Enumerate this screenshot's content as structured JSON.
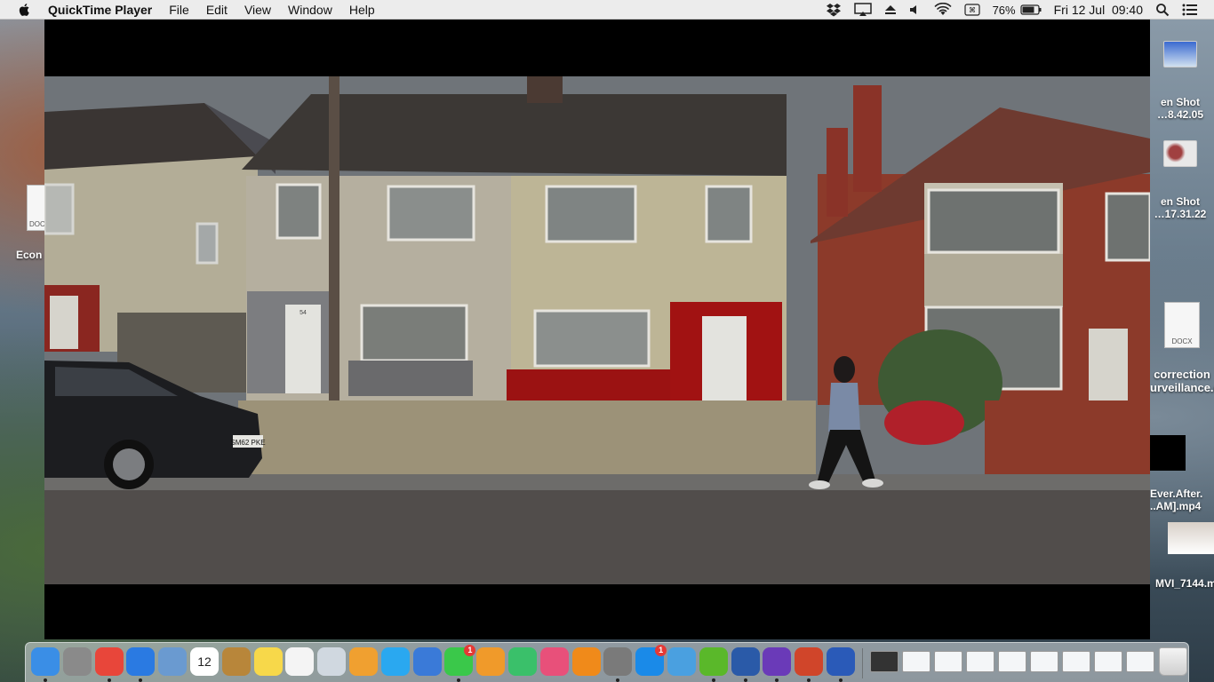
{
  "menubar": {
    "app_name": "QuickTime Player",
    "items": [
      "File",
      "Edit",
      "View",
      "Window",
      "Help"
    ],
    "status": {
      "battery": "76%",
      "datetime": "Fri 12 Jul  09:40"
    }
  },
  "window": {
    "title": "",
    "scene": {
      "number_plate": "SM62 PKE",
      "house_number": "54"
    }
  },
  "desktop_icons": [
    {
      "name": "en Shot\n…8.42.05",
      "line1": "en Shot",
      "line2": "…8.42.05"
    },
    {
      "name": "en Shot\n…17.31.22",
      "line1": "en Shot",
      "line2": "…17.31.22"
    },
    {
      "line1": "correction",
      "line2": "urveillance.d",
      "badge": "DOCX"
    },
    {
      "line1": "Ever.After.",
      "line2": "..AM].mp4"
    },
    {
      "line1": "MVI_7144.m"
    },
    {
      "line1": "Econ",
      "badge": "DOC"
    }
  ],
  "dock": {
    "apps": [
      {
        "name": "finder-icon",
        "color": "#3a8ee6"
      },
      {
        "name": "launchpad-icon",
        "color": "#8a8a8a"
      },
      {
        "name": "chrome-icon",
        "color": "#e8463a"
      },
      {
        "name": "safari-icon",
        "color": "#2a7ae2"
      },
      {
        "name": "preview-icon",
        "color": "#6a9ad0"
      },
      {
        "name": "calendar-icon",
        "color": "#ffffff",
        "label": "12"
      },
      {
        "name": "contacts-icon",
        "color": "#b8863a"
      },
      {
        "name": "notes-icon",
        "color": "#f7d84a"
      },
      {
        "name": "reminders-icon",
        "color": "#f4f4f4"
      },
      {
        "name": "preview-photos-icon",
        "color": "#d0d8e0"
      },
      {
        "name": "photos-icon",
        "color": "#f0a030"
      },
      {
        "name": "messages-icon",
        "color": "#2aa8f0"
      },
      {
        "name": "keynote-icon",
        "color": "#3a7ad8"
      },
      {
        "name": "facetime-icon",
        "color": "#3ac84a",
        "badge": "1"
      },
      {
        "name": "pages-icon",
        "color": "#f09a2a"
      },
      {
        "name": "numbers-icon",
        "color": "#3ac06a"
      },
      {
        "name": "itunes-icon",
        "color": "#e8507a"
      },
      {
        "name": "ibooks-icon",
        "color": "#f08a1a"
      },
      {
        "name": "system-preferences-icon",
        "color": "#7a7a7a"
      },
      {
        "name": "app-store-icon",
        "color": "#1a8ae8",
        "badge": "1"
      },
      {
        "name": "sigma-icon",
        "color": "#4aa0e0"
      },
      {
        "name": "utorrent-icon",
        "color": "#5ab82a"
      },
      {
        "name": "quicktime-icon",
        "color": "#2a5aa8"
      },
      {
        "name": "imovie-icon",
        "color": "#6a3ab8"
      },
      {
        "name": "powerpoint-icon",
        "color": "#d0452a"
      },
      {
        "name": "word-icon",
        "color": "#2a5ab8"
      }
    ],
    "docs": [
      {
        "name": "doc-thumbnail-1"
      },
      {
        "name": "doc-thumbnail-2"
      },
      {
        "name": "doc-thumbnail-3"
      },
      {
        "name": "doc-thumbnail-4"
      },
      {
        "name": "doc-thumbnail-5"
      },
      {
        "name": "doc-thumbnail-6"
      },
      {
        "name": "doc-thumbnail-7"
      },
      {
        "name": "doc-thumbnail-8"
      },
      {
        "name": "doc-thumbnail-9"
      }
    ],
    "trash": {
      "name": "trash-icon"
    }
  }
}
